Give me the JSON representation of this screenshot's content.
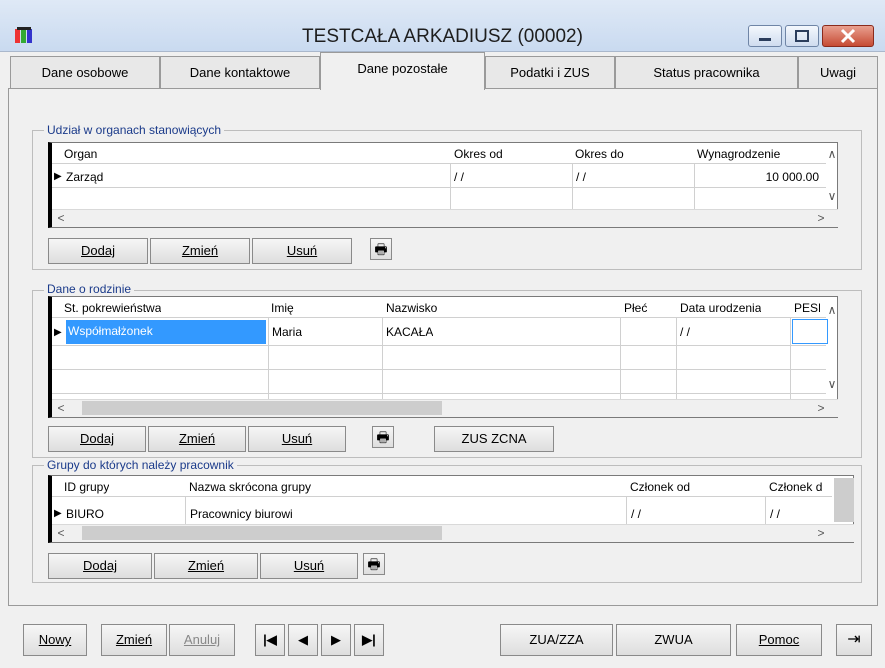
{
  "window": {
    "title": "TESTCAŁA ARKADIUSZ  (00002)",
    "minimize_glyph": "▭",
    "maximize_glyph": "▣",
    "close_glyph": "✕"
  },
  "tabs": [
    {
      "label": "Dane osobowe"
    },
    {
      "label": "Dane kontaktowe"
    },
    {
      "label": "Dane pozostałe"
    },
    {
      "label": "Podatki i ZUS"
    },
    {
      "label": "Status pracownika"
    },
    {
      "label": "Uwagi"
    }
  ],
  "organs": {
    "title": "Udział w organach stanowiących",
    "columns": [
      "Organ",
      "Okres od",
      "Okres do",
      "Wynagrodzenie"
    ],
    "rows": [
      [
        "Zarząd",
        "/ /",
        "/ /",
        "10 000.00"
      ]
    ],
    "buttons": {
      "add": "Dodaj",
      "change": "Zmień",
      "delete": "Usuń"
    }
  },
  "family": {
    "title": "Dane o rodzinie",
    "columns": [
      "St. pokrewieństwa",
      "Imię",
      "Nazwisko",
      "Płeć",
      "Data urodzenia",
      "PESE"
    ],
    "rows": [
      [
        "Współmałżonek",
        "Maria",
        "KACAŁA",
        "",
        "/ /",
        ""
      ]
    ],
    "buttons": {
      "add": "Dodaj",
      "change": "Zmień",
      "delete": "Usuń",
      "zus": "ZUS ZCNA"
    }
  },
  "groups": {
    "title": "Grupy do których należy pracownik",
    "columns": [
      "ID grupy",
      "Nazwa skrócona grupy",
      "Członek od",
      "Członek d"
    ],
    "rows": [
      [
        "BIURO",
        "Pracownicy biurowi",
        "/ /",
        "/ /"
      ]
    ],
    "buttons": {
      "add": "Dodaj",
      "change": "Zmień",
      "delete": "Usuń"
    }
  },
  "footer": {
    "new": "Nowy",
    "change": "Zmień",
    "cancel": "Anuluj",
    "zua": "ZUA/ZZA",
    "zwua": "ZWUA",
    "help": "Pomoc"
  },
  "icons": {
    "scroll_up": "∧",
    "scroll_down": "∨",
    "scroll_left": "<",
    "scroll_right": ">",
    "row_marker": "▶",
    "first": "|◀",
    "prev": "◀",
    "next": "▶",
    "last": "▶|",
    "print": "🖶",
    "exit": "⇥"
  }
}
